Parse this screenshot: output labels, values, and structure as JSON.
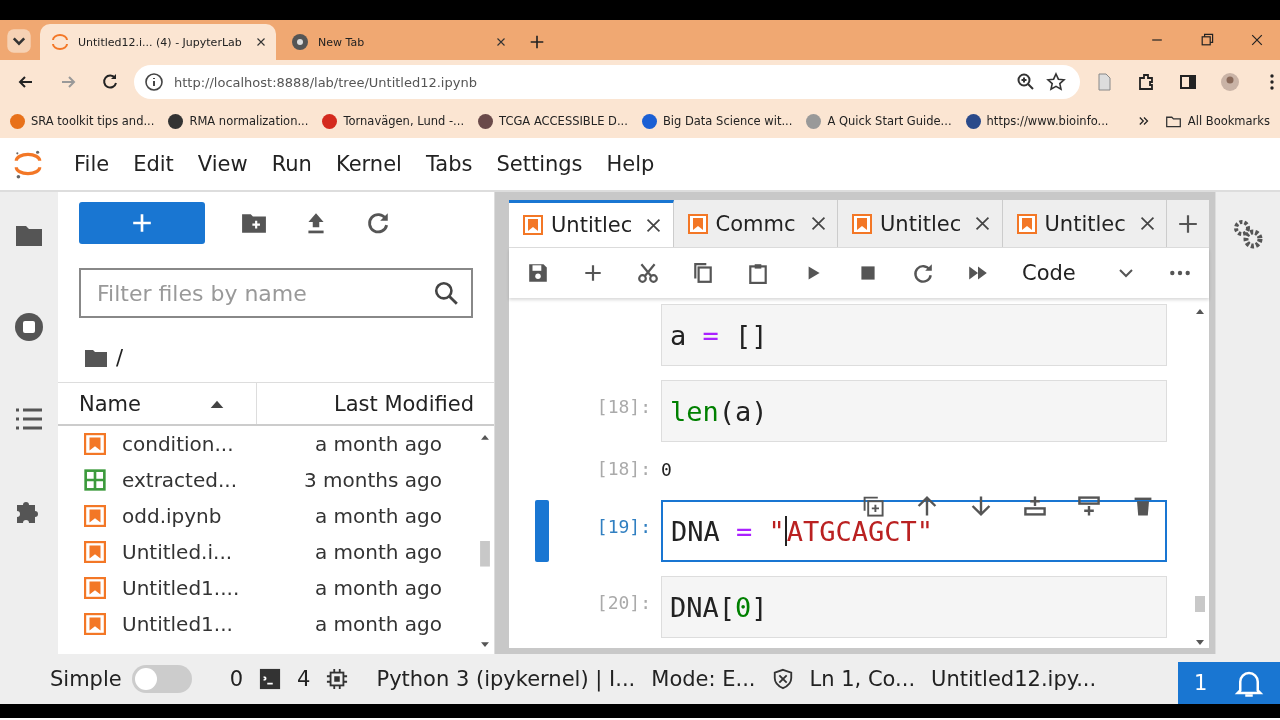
{
  "browser": {
    "tabs": [
      {
        "title": "Untitled12.i... (4) - JupyterLab",
        "selected": true
      },
      {
        "title": "New Tab",
        "selected": false
      }
    ],
    "address": {
      "host": "http://localhost",
      "rest": ":8888/lab/tree/Untitled12.ipynb"
    },
    "bookmarks": [
      {
        "label": "SRA toolkit tips and...",
        "color": "#e8711a"
      },
      {
        "label": "RMA normalization...",
        "color": "#333333"
      },
      {
        "label": "Tornavägen, Lund -...",
        "color": "#d42a1e"
      },
      {
        "label": "TCGA ACCESSIBLE D...",
        "color": "#6a4a4a"
      },
      {
        "label": "Big Data Science wit...",
        "color": "#1a5fd4"
      },
      {
        "label": "A Quick Start Guide...",
        "color": "#999999"
      },
      {
        "label": "https://www.bioinfo...",
        "color": "#2a4a8a"
      }
    ],
    "all_bookmarks": "All Bookmarks"
  },
  "menu": [
    "File",
    "Edit",
    "View",
    "Run",
    "Kernel",
    "Tabs",
    "Settings",
    "Help"
  ],
  "file_browser": {
    "filter_placeholder": "Filter files by name",
    "path": "/",
    "columns": [
      "Name",
      "Last Modified"
    ],
    "files": [
      {
        "name": "condition...",
        "modified": "a month ago",
        "kind": "notebook"
      },
      {
        "name": "extracted...",
        "modified": "3 months ago",
        "kind": "table"
      },
      {
        "name": "odd.ipynb",
        "modified": "a month ago",
        "kind": "notebook"
      },
      {
        "name": "Untitled.i...",
        "modified": "a month ago",
        "kind": "notebook"
      },
      {
        "name": "Untitled1....",
        "modified": "a month ago",
        "kind": "notebook"
      },
      {
        "name": "Untitled1...",
        "modified": "a month ago",
        "kind": "notebook"
      }
    ]
  },
  "notebook": {
    "tabs": [
      {
        "title": "Untitlec",
        "selected": true
      },
      {
        "title": "Commc",
        "selected": false
      },
      {
        "title": "Untitlec",
        "selected": false
      },
      {
        "title": "Untitlec",
        "selected": false
      }
    ],
    "cell_type": "Code",
    "cells": [
      {
        "active": false,
        "code": [
          {
            "text": "a",
            "kind": "name"
          },
          {
            "text": " = ",
            "kind": "op"
          },
          {
            "text": "[]",
            "kind": "name"
          }
        ]
      },
      {
        "prompt": "[18]:",
        "active": false,
        "code": [
          {
            "text": "len",
            "kind": "builtin"
          },
          {
            "text": "(a)",
            "kind": "name"
          }
        ],
        "output": {
          "prompt": "[18]:",
          "text": "0"
        }
      },
      {
        "prompt": "[19]:",
        "active": true,
        "code": [
          {
            "text": "DNA",
            "kind": "name"
          },
          {
            "text": " = ",
            "kind": "op"
          },
          {
            "text": "\"",
            "kind": "string"
          },
          {
            "text": "ATGCAGCT\"",
            "kind": "string"
          }
        ]
      },
      {
        "prompt": "[20]:",
        "active": false,
        "code": [
          {
            "text": "DNA[",
            "kind": "name"
          },
          {
            "text": "0",
            "kind": "number"
          },
          {
            "text": "]",
            "kind": "name"
          }
        ]
      }
    ]
  },
  "status_bar": {
    "mode_label": "Simple",
    "simple_on": false,
    "terminals": "0",
    "kernels": "4",
    "kernel": "Python 3 (ipykernel) | I...",
    "mode": "Mode: E...",
    "cursor": "Ln 1, Co...",
    "file": "Untitled12.ipy...",
    "notifications": "1"
  }
}
